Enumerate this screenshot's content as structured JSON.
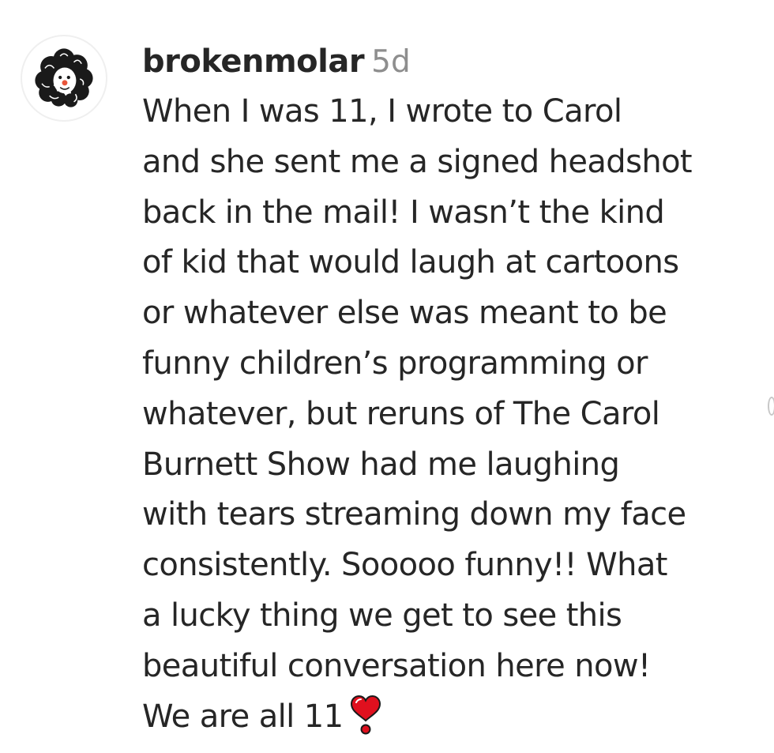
{
  "comment": {
    "username": "brokenmolar",
    "timestamp": "5d",
    "lines": [
      "When I was 11, I wrote to Carol",
      "and she sent me a signed headshot",
      "back in the mail! I wasn’t the kind",
      "of kid that would laugh at cartoons",
      "or whatever else was meant to be",
      "funny children’s programming or",
      "whatever, but reruns of The Carol",
      "Burnett Show had me laughing",
      "with tears streaming down my face",
      "consistently. Sooooo funny!! What",
      "a lucky thing we get to see this",
      "beautiful conversation here now!",
      "We are all 11"
    ],
    "emoji_icon": "heart-exclamation-icon"
  },
  "colors": {
    "text": "#262626",
    "muted": "#8e8e8e",
    "heart": "#e0101e"
  }
}
